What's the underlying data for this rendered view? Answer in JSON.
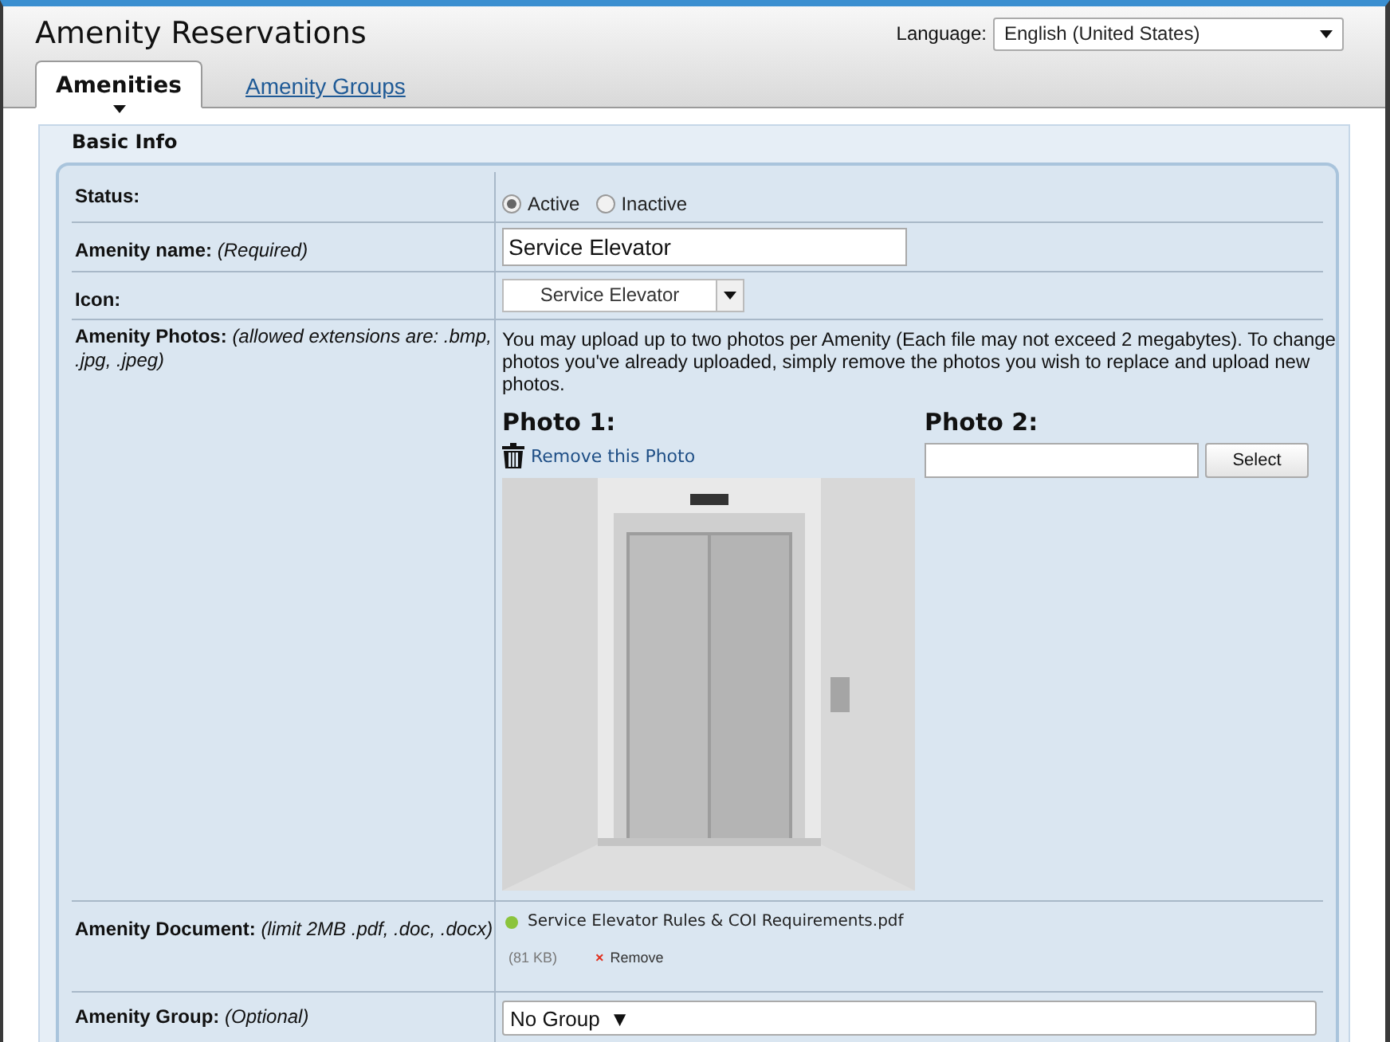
{
  "header": {
    "title": "Amenity Reservations",
    "language": {
      "label": "Language:",
      "value": "English (United States)"
    }
  },
  "tabs": [
    {
      "label": "Amenities",
      "selected": true
    },
    {
      "label": "Amenity Groups",
      "selected": false
    }
  ],
  "section": {
    "title": "Basic Info"
  },
  "status": {
    "label": "**Status:**",
    "options": [
      {
        "label": "Active",
        "selected": true
      },
      {
        "label": "Inactive",
        "selected": false
      }
    ]
  },
  "name": {
    "label": "**Amenity name:** *(Required)*",
    "value": "Service Elevator"
  },
  "icon": {
    "label": "**Icon:**",
    "value": "Service Elevator"
  },
  "photos": {
    "label": "**Amenity Photos:** *(allowed extensions are: .bmp, .jpg, .jpeg)*",
    "note": "You may upload up to two photos per Amenity (Each file may not exceed 2 megabytes). To change photos you've already uploaded, simply remove the photos you wish to replace and upload new photos.",
    "photo_1": {
      "title": "Photo 1:",
      "remove": "Remove this Photo",
      "kind": "picture"
    },
    "photo_2": {
      "title": "Photo 2:",
      "button": "Select"
    }
  },
  "document": {
    "label": "**Amenity Document:** *(limit 2MB .pdf, .doc, .docx)*",
    "file": "Service Elevator Rules & COI Requirements.pdf",
    "size": "(81 KB)",
    "remove_mark": "×",
    "remove": "Remove"
  },
  "group": {
    "label": "**Amenity Group:** *(Optional)*",
    "value": "No Group",
    "caret": "▼"
  }
}
